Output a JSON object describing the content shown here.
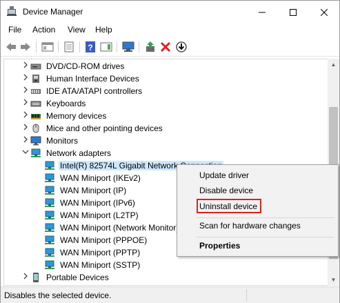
{
  "window": {
    "title": "Device Manager"
  },
  "menu": [
    "File",
    "Action",
    "View",
    "Help"
  ],
  "toolbar_icons": [
    "back-arrow-icon",
    "forward-arrow-icon",
    "show-hide-console-tree-icon",
    "properties-icon",
    "help-icon",
    "action-pane-icon",
    "scan-hardware-icon",
    "update-driver-icon",
    "uninstall-device-icon",
    "download-icon"
  ],
  "tree": {
    "rows": [
      {
        "label": "DVD/CD-ROM drives",
        "icon": "dvd-drive-icon",
        "expanded": false
      },
      {
        "label": "Human Interface Devices",
        "icon": "hid-icon",
        "expanded": false
      },
      {
        "label": "IDE ATA/ATAPI controllers",
        "icon": "ide-controller-icon",
        "expanded": false
      },
      {
        "label": "Keyboards",
        "icon": "keyboard-icon",
        "expanded": false
      },
      {
        "label": "Memory devices",
        "icon": "memory-icon",
        "expanded": false
      },
      {
        "label": "Mice and other pointing devices",
        "icon": "mouse-icon",
        "expanded": false
      },
      {
        "label": "Monitors",
        "icon": "monitor-icon",
        "expanded": false
      },
      {
        "label": "Network adapters",
        "icon": "network-adapter-icon",
        "expanded": true
      },
      {
        "label": "Intel(R) 82574L Gigabit Network Connection",
        "icon": "network-adapter-icon",
        "child": true,
        "selected": true
      },
      {
        "label": "WAN Miniport (IKEv2)",
        "icon": "network-adapter-icon",
        "child": true
      },
      {
        "label": "WAN Miniport (IP)",
        "icon": "network-adapter-icon",
        "child": true
      },
      {
        "label": "WAN Miniport (IPv6)",
        "icon": "network-adapter-icon",
        "child": true
      },
      {
        "label": "WAN Miniport (L2TP)",
        "icon": "network-adapter-icon",
        "child": true
      },
      {
        "label": "WAN Miniport (Network Monitor)",
        "icon": "network-adapter-icon",
        "child": true
      },
      {
        "label": "WAN Miniport (PPPOE)",
        "icon": "network-adapter-icon",
        "child": true
      },
      {
        "label": "WAN Miniport (PPTP)",
        "icon": "network-adapter-icon",
        "child": true
      },
      {
        "label": "WAN Miniport (SSTP)",
        "icon": "network-adapter-icon",
        "child": true
      },
      {
        "label": "Portable Devices",
        "icon": "portable-device-icon",
        "expanded": false
      }
    ]
  },
  "context_menu": {
    "items": [
      {
        "label": "Update driver"
      },
      {
        "label": "Disable device"
      },
      {
        "label": "Uninstall device",
        "highlighted": true
      },
      {
        "label": "Scan for hardware changes"
      },
      {
        "label": "Properties",
        "bold": true
      }
    ]
  },
  "status": {
    "text": "Disables the selected device."
  },
  "colors": {
    "selection": "#cce8ff",
    "highlight_box": "#e0201e",
    "uninstall_icon": "#e02020",
    "monitor_blue": "#2a7ad5"
  }
}
